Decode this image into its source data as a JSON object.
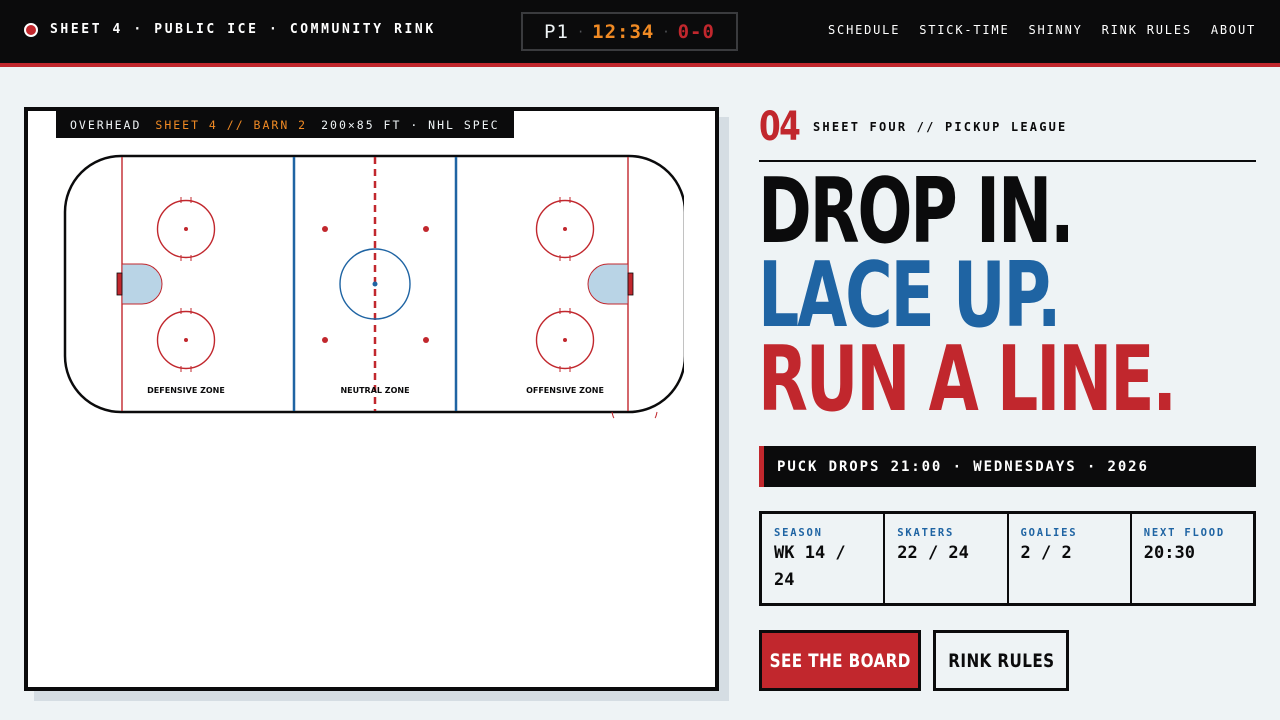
{
  "header": {
    "brand": "SHEET 4 · PUBLIC ICE · COMMUNITY RINK",
    "scoreboard": {
      "period": "P1",
      "sep1": "·",
      "clock": "12:34",
      "sep2": "·",
      "score": "0-0"
    },
    "nav": [
      "SCHEDULE",
      "STICK-TIME",
      "SHINNY",
      "RINK RULES",
      "ABOUT"
    ]
  },
  "rink": {
    "tag": {
      "view": "OVERHEAD",
      "location": "SHEET 4 // BARN 2",
      "spec": "200×85 FT · NHL SPEC"
    },
    "zones": [
      "DEFENSIVE ZONE",
      "NEUTRAL ZONE",
      "OFFENSIVE ZONE"
    ]
  },
  "hero": {
    "number": "04",
    "eyebrow": "SHEET FOUR // PICKUP LEAGUE",
    "lines": [
      "DROP IN.",
      "LACE UP.",
      "RUN A LINE."
    ],
    "puck_drop": "PUCK DROPS 21:00 · WEDNESDAYS · 2026"
  },
  "stats": [
    {
      "label": "SEASON",
      "value": "WK 14 / 24"
    },
    {
      "label": "SKATERS",
      "value": "22 / 24"
    },
    {
      "label": "GOALIES",
      "value": "2 / 2"
    },
    {
      "label": "NEXT FLOOD",
      "value": "20:30"
    }
  ],
  "actions": {
    "primary": "SEE THE BOARD",
    "secondary": "RINK RULES"
  },
  "colors": {
    "ink": "#0b0b0c",
    "red": "#c1272d",
    "blue": "#1f64a3",
    "amber": "#f08a24",
    "ice": "#eef3f5",
    "crease": "#b9d4e6"
  }
}
